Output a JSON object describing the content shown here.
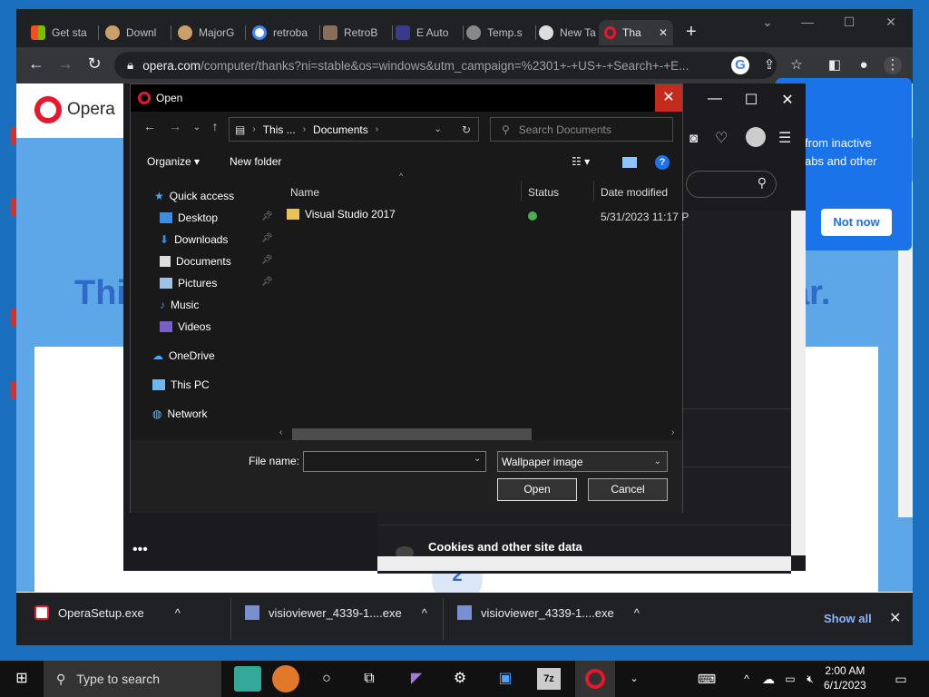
{
  "browser": {
    "tabs": [
      "Get sta",
      "Downl",
      "MajorG",
      "retroba",
      "RetroB",
      "E Auto",
      "Temp.s",
      "New Ta",
      "Tha"
    ],
    "address": {
      "host": "opera.com",
      "path": "/computer/thanks?ni=stable&os=windows&utm_campaign=%2301+-+US+-+Search+-+E..."
    }
  },
  "opera_page": {
    "logo_text": "Opera",
    "headline_left": "Thi",
    "headline_right": "ar.",
    "popup_text_1": "from inactive",
    "popup_text_2": "abs and other",
    "popup_button": "Not now",
    "step_number": "2"
  },
  "installer": {
    "cookies": "Cookies and other site data"
  },
  "dialog": {
    "title": "Open",
    "breadcrumb": [
      "This ...",
      "Documents"
    ],
    "search_placeholder": "Search Documents",
    "toolbar": {
      "organize": "Organize",
      "new_folder": "New folder"
    },
    "nav": {
      "quick_access": "Quick access",
      "items": [
        "Desktop",
        "Downloads",
        "Documents",
        "Pictures",
        "Music",
        "Videos"
      ],
      "onedrive": "OneDrive",
      "this_pc": "This PC",
      "network": "Network"
    },
    "columns": {
      "name": "Name",
      "status": "Status",
      "date": "Date modified"
    },
    "files": [
      {
        "name": "Visual Studio 2017",
        "date": "5/31/2023 11:17 P"
      }
    ],
    "file_name_label": "File name:",
    "file_name_value": "",
    "file_type": "Wallpaper image",
    "open_button": "Open",
    "cancel_button": "Cancel"
  },
  "downloads": {
    "items": [
      "OperaSetup.exe",
      "visioviewer_4339-1....exe",
      "visioviewer_4339-1....exe"
    ],
    "show_all": "Show all"
  },
  "taskbar": {
    "search_placeholder": "Type to search",
    "time": "2:00 AM",
    "date": "6/1/2023"
  }
}
